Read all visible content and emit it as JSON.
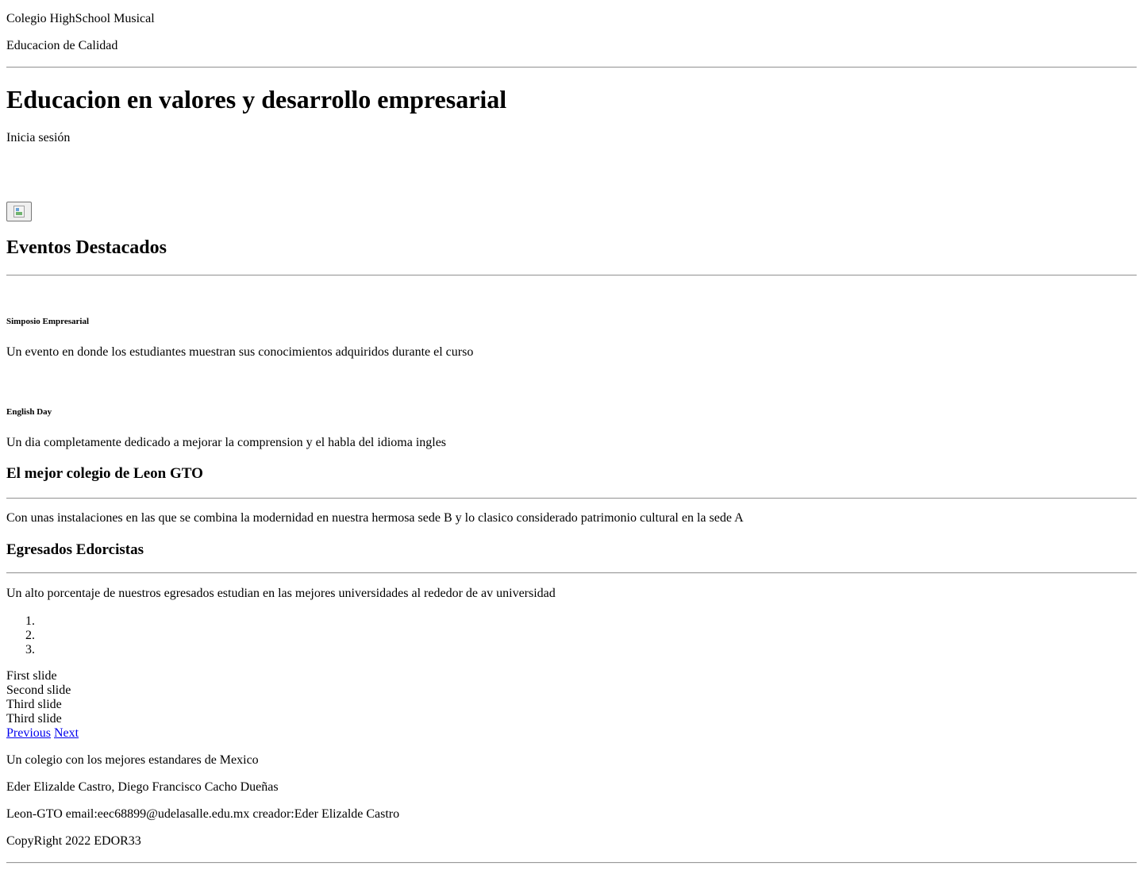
{
  "header": {
    "school_name": "Colegio HighSchool Musical",
    "tagline": "Educacion de Calidad"
  },
  "hero": {
    "title": "Educacion en valores y desarrollo empresarial",
    "login_text": "Inicia sesión"
  },
  "events": {
    "heading": "Eventos Destacados",
    "items": [
      {
        "title": "Simposio Empresarial",
        "description": "Un evento en donde los estudiantes muestran sus conocimientos adquiridos durante el curso"
      },
      {
        "title": "English Day",
        "description": "Un dia completamente dedicado a mejorar la comprension y el habla del idioma ingles"
      }
    ]
  },
  "sections": [
    {
      "heading": "El mejor colegio de Leon GTO",
      "text": "Con unas instalaciones en las que se combina la modernidad en nuestra hermosa sede B y lo clasico considerado patrimonio cultural en la sede A"
    },
    {
      "heading": "Egresados Edorcistas",
      "text": "Un alto porcentaje de nuestros egresados estudian en las mejores universidades al rededor de av universidad"
    }
  ],
  "carousel": {
    "slides": [
      {
        "alt": "First slide"
      },
      {
        "alt": "Second slide"
      },
      {
        "alt": "Third slide"
      },
      {
        "alt": "Third slide"
      }
    ],
    "prev_label": "Previous",
    "next_label": "Next"
  },
  "footer": {
    "slogan": "Un colegio con los mejores estandares de Mexico",
    "authors": "Eder Elizalde Castro, Diego Francisco Cacho Dueñas",
    "contact": "Leon-GTO email:eec68899@udelasalle.edu.mx creador:Eder Elizalde Castro",
    "copyright": "CopyRight 2022 EDOR33"
  }
}
